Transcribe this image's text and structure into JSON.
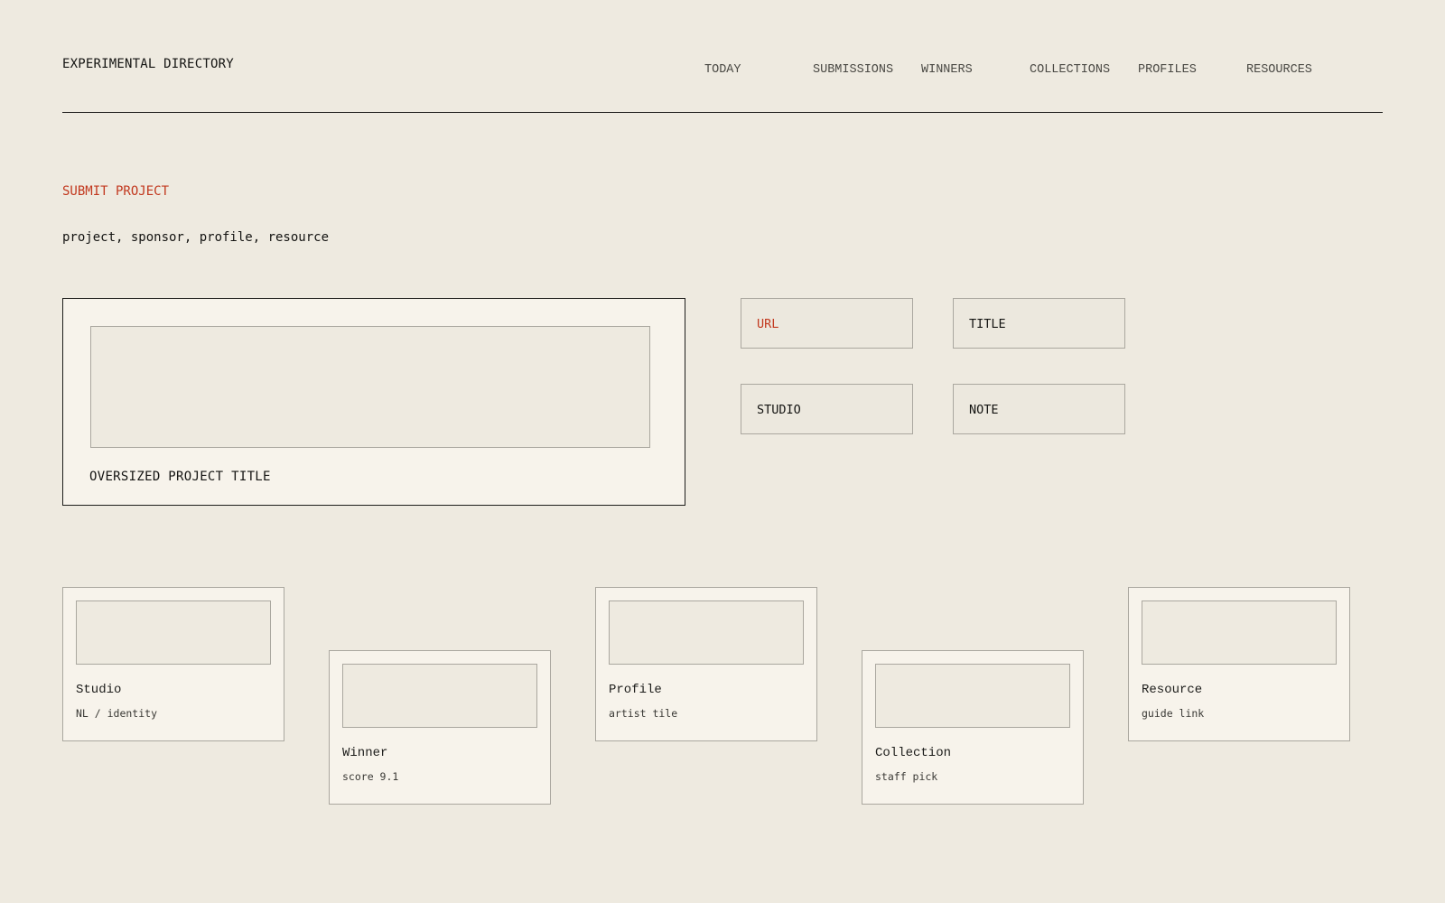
{
  "header": {
    "brand": "EXPERIMENTAL DIRECTORY",
    "nav": [
      "TODAY",
      "SUBMISSIONS",
      "WINNERS",
      "COLLECTIONS",
      "PROFILES",
      "RESOURCES"
    ]
  },
  "intro": {
    "submit_label": "SUBMIT PROJECT",
    "subtitle": "project, sponsor, profile, resource"
  },
  "feature": {
    "title": "OVERSIZED PROJECT TITLE"
  },
  "form": {
    "fields": [
      "URL",
      "TITLE",
      "STUDIO",
      "NOTE"
    ]
  },
  "tiles": [
    {
      "title": "Studio",
      "meta": "NL / identity"
    },
    {
      "title": "Winner",
      "meta": "score 9.1"
    },
    {
      "title": "Profile",
      "meta": "artist tile"
    },
    {
      "title": "Collection",
      "meta": "staff pick"
    },
    {
      "title": "Resource",
      "meta": "guide link"
    }
  ],
  "colors": {
    "background": "#eeeae0",
    "card": "#f7f3eb",
    "accent": "#c2391f",
    "border": "#aaa79f",
    "ink": "#1d1d1b"
  }
}
